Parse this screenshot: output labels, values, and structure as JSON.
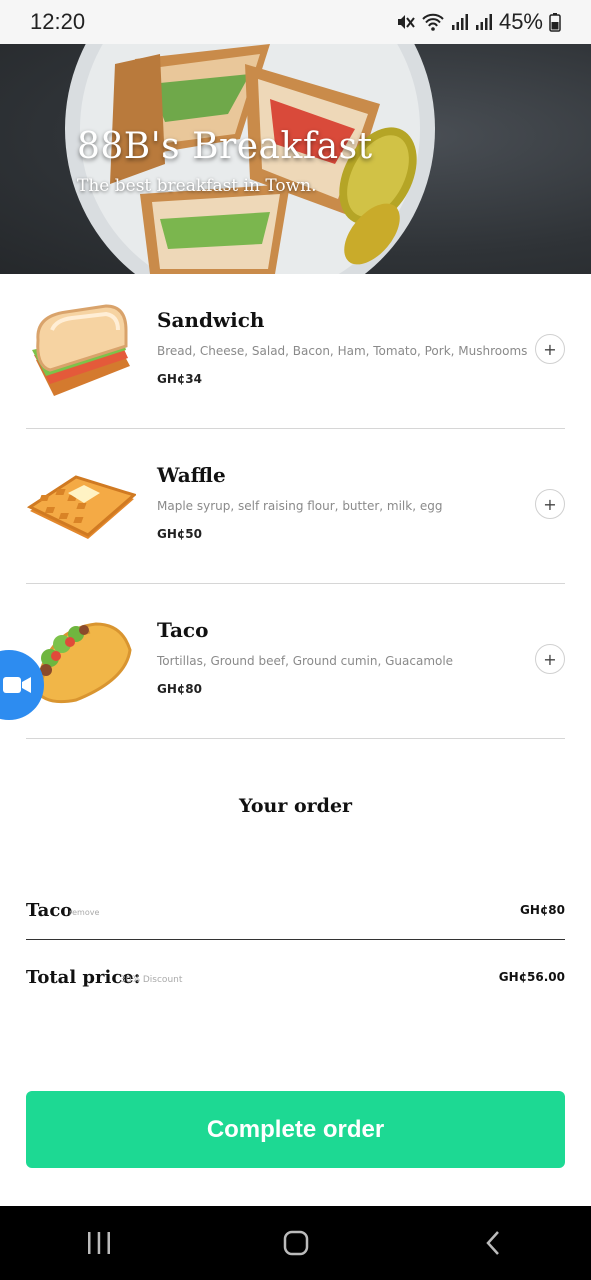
{
  "status_bar": {
    "time": "12:20",
    "battery": "45%",
    "icons": [
      "mute-icon",
      "wifi-icon",
      "signal-icon",
      "signal-icon",
      "battery-icon"
    ]
  },
  "hero": {
    "title": "88B's Breakfast",
    "subtitle": "The best breakfast in Town."
  },
  "menu": {
    "items": [
      {
        "name": "Sandwich",
        "description": "Bread, Cheese, Salad, Bacon, Ham, Tomato, Pork, Mushrooms",
        "price": "GH¢34",
        "add_label": "+",
        "icon": "sandwich-icon"
      },
      {
        "name": "Waffle",
        "description": "Maple syrup, self raising flour, butter, milk, egg",
        "price": "GH¢50",
        "add_label": "+",
        "icon": "waffle-icon"
      },
      {
        "name": "Taco",
        "description": "Tortillas, Ground beef, Ground cumin, Guacamole",
        "price": "GH¢80",
        "add_label": "+",
        "icon": "taco-icon"
      }
    ]
  },
  "order": {
    "heading": "Your order",
    "lines": [
      {
        "name": "Taco",
        "remove_label": "remove",
        "price": "GH¢80"
      }
    ],
    "total_label": "Total price:",
    "discount_note": "30% Discount",
    "total_price": "GH¢56.00",
    "complete_label": "Complete order"
  },
  "colors": {
    "accent": "#1dd993",
    "bubble": "#2d8cf0"
  }
}
